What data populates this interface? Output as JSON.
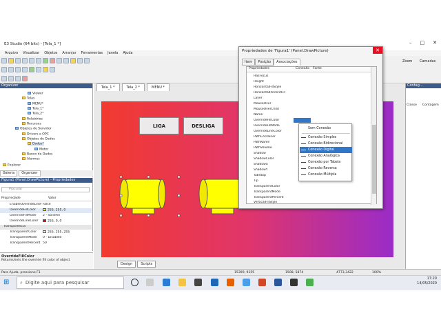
{
  "window": {
    "title": "E3 Studio (64 bits) - [Tela_1 *]"
  },
  "menu": [
    "Arquivo",
    "Visualizar",
    "Objetos",
    "Arranjar",
    "Ferramentas",
    "Janela",
    "Ajuda"
  ],
  "toolbar_right": {
    "zoom_label": "Zoom",
    "camadas_label": "Camadas"
  },
  "organizer": {
    "header": "Organizer",
    "tree": [
      "Viewer",
      "Telas",
      "MENU*",
      "Tela_1*",
      "Tela_2*",
      "Relatórios",
      "Recursos",
      "Objetos de Servidor",
      "Drivers e OPC",
      "Objetos de Dados",
      "Dados*",
      "Motor",
      "Banco de Dados",
      "Alarmes",
      "Explorer"
    ],
    "tabs": [
      "Galeria",
      "Organizer"
    ]
  },
  "properties_panel": {
    "header": "Figura1 (Panel.DrawPicture) - Propriedades",
    "search_placeholder": "Procurar",
    "col_prop": "Propriedade",
    "col_val": "Valor",
    "rows": [
      {
        "name": "EnableOverrideLineColor",
        "value": "False",
        "color": ""
      },
      {
        "name": "OverrideFillColor",
        "value": "255, 255, 0",
        "color": "#ffff00"
      },
      {
        "name": "OverrideFillMode",
        "value": "2 - SolidFill",
        "color": ""
      },
      {
        "name": "OverrideLineColor",
        "value": "255, 0, 0",
        "color": "#ff0000"
      },
      {
        "name": "Transparência",
        "value": "",
        "color": ""
      },
      {
        "name": "TransparentColor",
        "value": "255, 255, 255",
        "color": "#ffffff"
      },
      {
        "name": "TransparentMode",
        "value": "0 - Disabled",
        "color": ""
      },
      {
        "name": "TransparentPercent",
        "value": "50",
        "color": ""
      }
    ],
    "desc_title": "OverrideFillColor",
    "desc_text": "Returns/sets the override fill color of object"
  },
  "canvas": {
    "tabs": [
      "Tela_1 *",
      "Tela_2 *",
      "MENU *"
    ],
    "btn_liga": "LIGA",
    "btn_desliga": "DESLIGA",
    "bottom_tabs": [
      "Design",
      "Scripts"
    ]
  },
  "right_panel": {
    "header": "Contag...",
    "cols": [
      "Classe",
      "Contagem"
    ]
  },
  "dialog": {
    "title": "Propriedades de 'Figura1' (Panel.DrawPicture)",
    "tabs": [
      "Item",
      "Posição",
      "Associações"
    ],
    "head": [
      "Propriedades",
      "Conexão",
      "Fonte"
    ],
    "rows": [
      "HasFocus",
      "Height",
      "HorizontalFillStyle",
      "HorizontalPercentFill",
      "Layer",
      "MouseOver",
      "MouseOverChild",
      "Name",
      "OverrideFillColor",
      "OverrideFillMode",
      "OverrideLineColor",
      "PathContainer",
      "PathName",
      "PathVolume",
      "Shadow",
      "ShadowColor",
      "ShadowX",
      "ShadowY",
      "TabStop",
      "Tip",
      "TransparentColor",
      "TransparentMode",
      "TransparentPercent",
      "VerticalFillStyle"
    ],
    "selected": "OverrideFillColor"
  },
  "context_menu": {
    "items": [
      "Sem Conexão",
      "Conexão Simples",
      "Conexão Bidirecional",
      "Conexão Digital",
      "Conexão Analógica",
      "Conexão por Tabela",
      "Conexão Reversa",
      "Conexão Múltipla"
    ],
    "highlighted": "Conexão Digital"
  },
  "statusbar": {
    "help": "Para Ajuda, pressione F1",
    "coords1": "15399, 9155",
    "coords2": "1508, 5874",
    "size": "4773,3422",
    "zoom": "100%"
  },
  "taskbar": {
    "search_placeholder": "Digite aqui para pesquisar",
    "time": "17:20",
    "date": "14/05/2020"
  },
  "colors": {
    "canvas_start": "#f23a2f",
    "canvas_end": "#9a2cc8",
    "motor_fill": "#ffff00",
    "selection": "#3277c7"
  }
}
